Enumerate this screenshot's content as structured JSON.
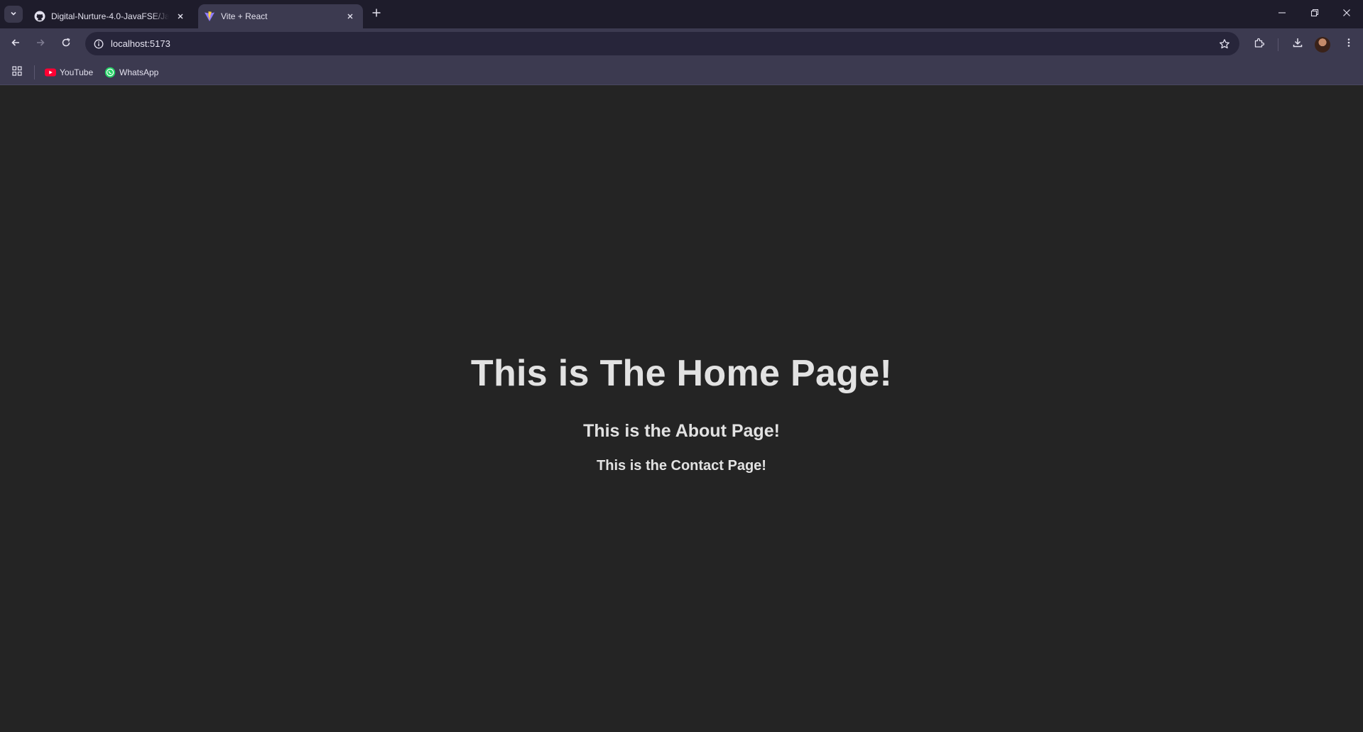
{
  "tabs": [
    {
      "title": "Digital-Nurture-4.0-JavaFSE/Jav",
      "favicon": "github-icon",
      "active": false
    },
    {
      "title": "Vite + React",
      "favicon": "vite-icon",
      "active": true
    }
  ],
  "toolbar": {
    "url": "localhost:5173"
  },
  "bookmarks": [
    {
      "label": "YouTube",
      "icon": "youtube-icon"
    },
    {
      "label": "WhatsApp",
      "icon": "whatsapp-icon"
    }
  ],
  "page": {
    "home_heading": "This is The Home Page!",
    "about_heading": "This is the About Page!",
    "contact_heading": "This is the Contact Page!"
  },
  "colors": {
    "page_background": "#242424",
    "tab_strip": "#1e1c2b",
    "toolbar": "#3c3a50",
    "omnibox": "#27253a",
    "text": "#dedede"
  }
}
